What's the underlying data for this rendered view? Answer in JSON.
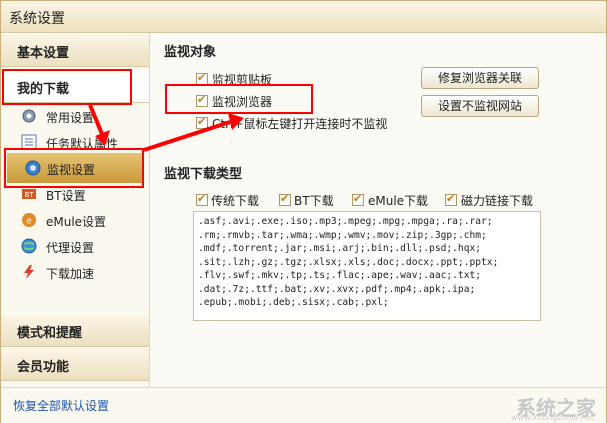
{
  "window": {
    "title": "系统设置"
  },
  "sidebar": {
    "sections": {
      "basic": "基本设置",
      "my_download": "我的下载",
      "mode": "模式和提醒",
      "member": "会员功能"
    },
    "items": [
      {
        "label": "常用设置",
        "icon": "gear-icon"
      },
      {
        "label": "任务默认属性",
        "icon": "list-icon"
      },
      {
        "label": "监视设置",
        "icon": "monitor-eye-icon",
        "active": true
      },
      {
        "label": "BT设置",
        "icon": "bt-icon"
      },
      {
        "label": "eMule设置",
        "icon": "emule-icon"
      },
      {
        "label": "代理设置",
        "icon": "globe-icon"
      },
      {
        "label": "下载加速",
        "icon": "lightning-icon"
      }
    ]
  },
  "monitor_object": {
    "title": "监视对象",
    "clipboard": "监视剪贴板",
    "browser": "监视浏览器",
    "ctrl_click": "Ctrl+鼠标左键打开连接时不监视",
    "repair_button": "修复浏览器关联",
    "exclude_button": "设置不监视网站"
  },
  "monitor_types": {
    "title": "监视下载类型",
    "traditional": "传统下载",
    "bt": "BT下载",
    "emule": "eMule下载",
    "magnet": "磁力链接下载",
    "extensions": ".asf;.avi;.exe;.iso;.mp3;.mpeg;.mpg;.mpga;.ra;.rar;\n.rm;.rmvb;.tar;.wma;.wmp;.wmv;.mov;.zip;.3gp;.chm;\n.mdf;.torrent;.jar;.msi;.arj;.bin;.dll;.psd;.hqx;\n.sit;.lzh;.gz;.tgz;.xlsx;.xls;.doc;.docx;.ppt;.pptx;\n.flv;.swf;.mkv;.tp;.ts;.flac;.ape;.wav;.aac;.txt;\n.dat;.7z;.ttf;.bat;.xv;.xvx;.pdf;.mp4;.apk;.ipa;\n.epub;.mobi;.deb;.sisx;.cab;.pxl;"
  },
  "footer": {
    "restore": "恢复全部默认设置",
    "watermark": "系统之家",
    "watermark_url": "www.xitongzhijia.net"
  },
  "colors": {
    "accent": "#c9983a",
    "highlight": "#ff0000",
    "link": "#1a56b0"
  }
}
